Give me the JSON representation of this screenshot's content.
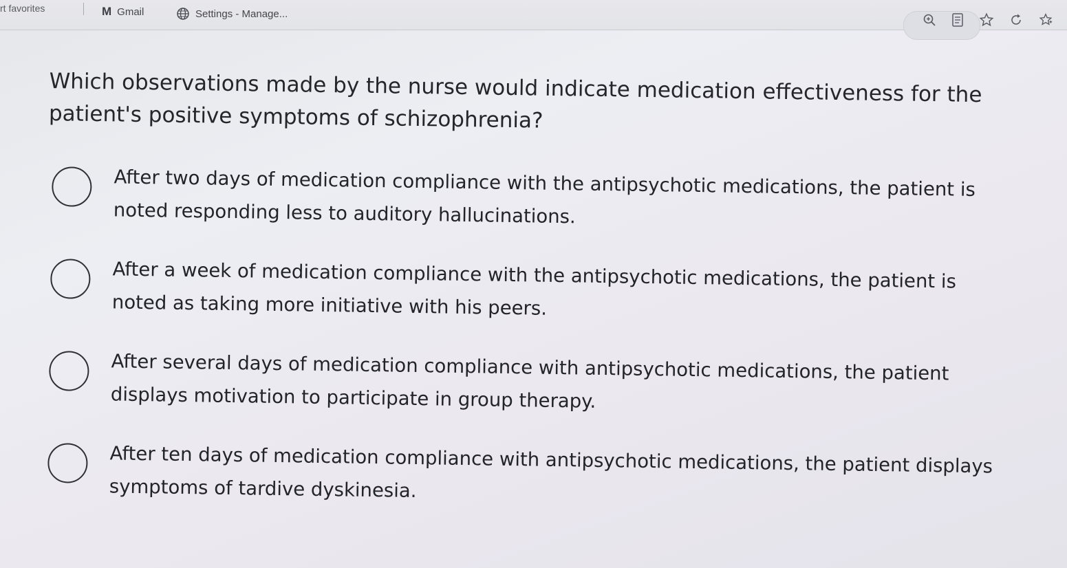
{
  "bookmarks": {
    "favorites_label": "rt favorites",
    "gmail_label": "Gmail",
    "settings_label": "Settings - Manage..."
  },
  "toolbar": {
    "icons": [
      "zoom-icon",
      "reader-icon",
      "favorite-star-icon",
      "refresh-icon",
      "collections-icon"
    ]
  },
  "quiz": {
    "question": "Which observations made by the nurse would indicate medication effectiveness for the patient's positive symptoms of schizophrenia?",
    "options": [
      {
        "label": "After two days of medication compliance with the antipsychotic medications, the patient is noted responding less to auditory hallucinations."
      },
      {
        "label": "After a week of medication compliance with the antipsychotic medications, the patient is noted as taking more initiative with his peers."
      },
      {
        "label": "After several days of medication compliance with antipsychotic medications, the patient displays motivation to participate in group therapy."
      },
      {
        "label": "After ten days of medication compliance with antipsychotic medications, the patient displays symptoms of tardive dyskinesia."
      }
    ]
  },
  "colors": {
    "background": "#e9e9ee",
    "text": "#1f1f24",
    "bar": "#e6e6ea"
  }
}
